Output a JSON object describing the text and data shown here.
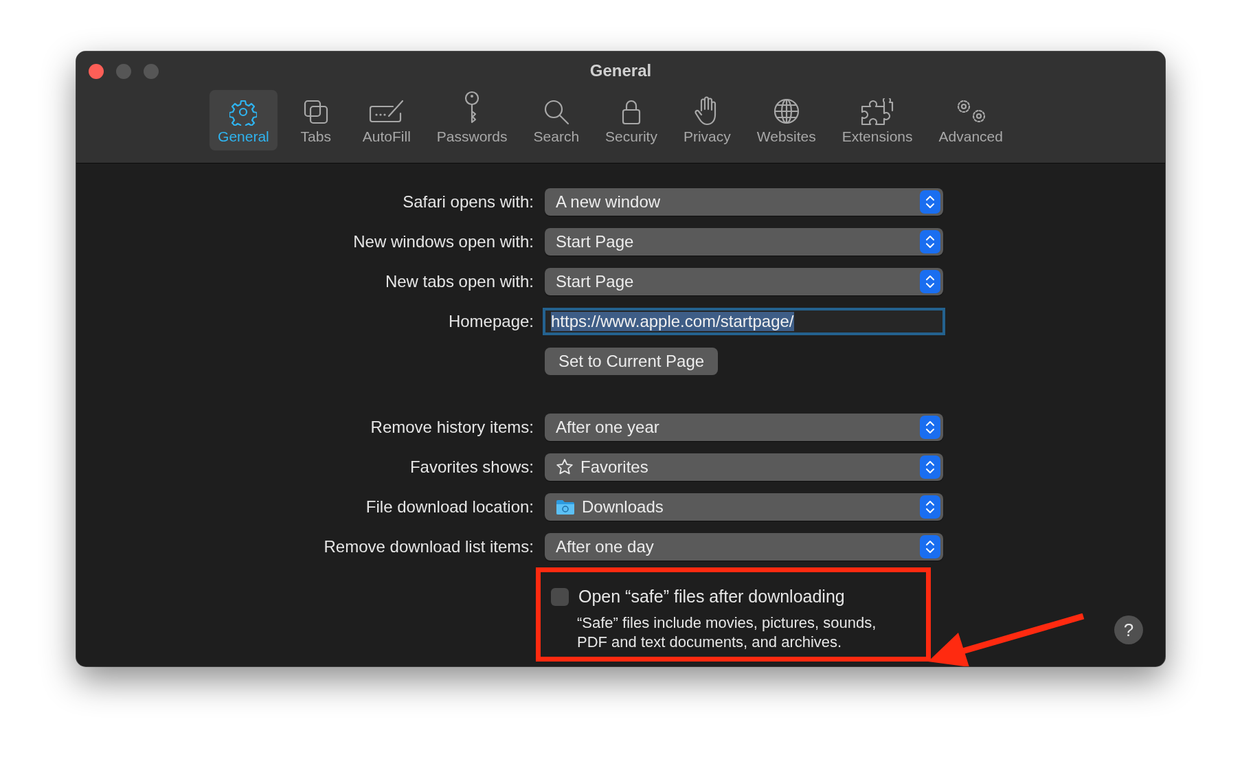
{
  "window": {
    "title": "General"
  },
  "tabs": [
    {
      "label": "General",
      "selected": true
    },
    {
      "label": "Tabs",
      "selected": false
    },
    {
      "label": "AutoFill",
      "selected": false
    },
    {
      "label": "Passwords",
      "selected": false
    },
    {
      "label": "Search",
      "selected": false
    },
    {
      "label": "Security",
      "selected": false
    },
    {
      "label": "Privacy",
      "selected": false
    },
    {
      "label": "Websites",
      "selected": false
    },
    {
      "label": "Extensions",
      "selected": false
    },
    {
      "label": "Advanced",
      "selected": false
    }
  ],
  "settings": [
    {
      "kind": "popup",
      "label": "Safari opens with:",
      "value": "A new window"
    },
    {
      "kind": "popup",
      "label": "New windows open with:",
      "value": "Start Page"
    },
    {
      "kind": "popup",
      "label": "New tabs open with:",
      "value": "Start Page"
    },
    {
      "kind": "field",
      "label": "Homepage:",
      "value": "https://www.apple.com/startpage/",
      "focused": true
    },
    {
      "kind": "button",
      "label_button": "Set to Current Page"
    },
    {
      "kind": "spacer"
    },
    {
      "kind": "popup",
      "label": "Remove history items:",
      "value": "After one year"
    },
    {
      "kind": "starpopup",
      "label": "Favorites shows:",
      "value": "Favorites"
    },
    {
      "kind": "folderpopup",
      "label": "File download location:",
      "value": "Downloads"
    },
    {
      "kind": "popup",
      "label": "Remove download list items:",
      "value": "After one day"
    }
  ],
  "safe_files": {
    "label": "Open “safe” files after downloading",
    "checked": false,
    "note": "“Safe” files include movies, pictures, sounds, PDF and text documents, and archives."
  },
  "help": {
    "label": "?"
  }
}
